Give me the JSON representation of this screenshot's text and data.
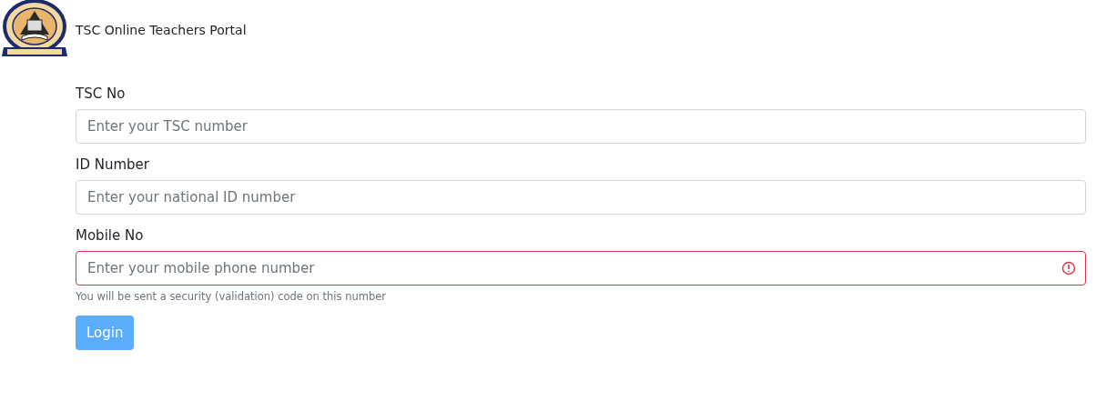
{
  "header": {
    "title": "TSC Online Teachers Portal"
  },
  "fields": [
    {
      "label": "TSC No",
      "placeholder": "Enter your TSC number",
      "invalid": false
    },
    {
      "label": "ID Number",
      "placeholder": "Enter your national ID number",
      "invalid": false
    },
    {
      "label": "Mobile No",
      "placeholder": "Enter your mobile phone number",
      "invalid": true,
      "help": "You will be sent a security (validation) code on this number"
    }
  ],
  "login_button": {
    "label": "Login",
    "disabled": true
  }
}
